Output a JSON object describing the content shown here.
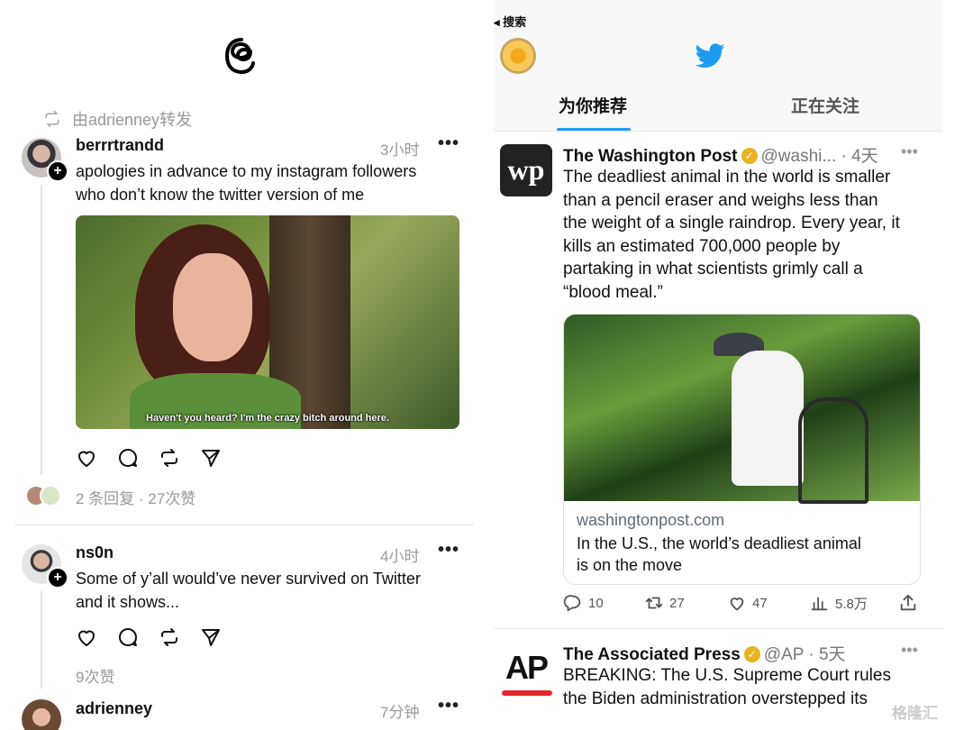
{
  "threads": {
    "repost_label": "由adrienney转发",
    "posts": [
      {
        "username": "berrrtrandd",
        "time": "3小时",
        "text_line1": "apologies in advance to my instagram followers",
        "text_line2": "who don’t know the twitter version of me",
        "image_caption": "Haven't you heard? I'm the crazy bitch around here.",
        "stats": "2 条回复 · 27次赞"
      },
      {
        "username": "ns0n",
        "time": "4小时",
        "text_line1": "Some of y’all would’ve never survived on Twitter",
        "text_line2": "and it shows...",
        "stats": "9次赞"
      },
      {
        "username": "adrienney",
        "time": "7分钟"
      }
    ]
  },
  "twitter": {
    "back_label": "◂ 搜索",
    "tabs": [
      "为你推荐",
      "正在关注"
    ],
    "accent": "#1d9bf0",
    "tweets": [
      {
        "name": "The Washington Post",
        "handle_time": "@washi... · 4天",
        "avatar_text": "wp",
        "lines": [
          "The deadliest animal in the world is smaller",
          "than a pencil eraser and weighs less than",
          "the weight of a single raindrop. Every year, it",
          "kills an estimated 700,000 people by",
          "partaking in what scientists grimly call a",
          "“blood meal.”"
        ],
        "card_domain": "washingtonpost.com",
        "card_title_line1": "In the U.S., the world’s deadliest animal",
        "card_title_line2": "is on the move",
        "replies": "10",
        "retweets": "27",
        "likes": "47",
        "views": "5.8万"
      },
      {
        "name": "The Associated Press",
        "handle_time": "@AP · 5天",
        "avatar_text": "AP",
        "lines": [
          "BREAKING: The U.S. Supreme Court rules",
          "the Biden administration overstepped its"
        ]
      }
    ]
  },
  "watermark": "格隆汇"
}
